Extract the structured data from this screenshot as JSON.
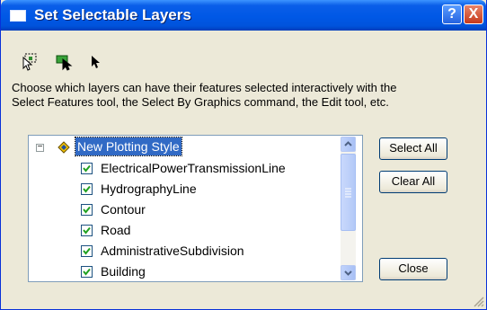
{
  "window": {
    "title": "Set Selectable Layers",
    "help_glyph": "?",
    "close_glyph": "X"
  },
  "toolbar": {
    "icons": [
      "select-features-icon",
      "select-by-graphics-icon",
      "edit-tool-icon"
    ]
  },
  "description": {
    "line1": "Choose which layers can have their features selected interactively with the",
    "line2": "Select Features tool, the Select By Graphics command, the Edit tool, etc."
  },
  "tree": {
    "expander": "−",
    "root_label": "New Plotting Style",
    "layers": [
      {
        "label": "ElectricalPowerTransmissionLine",
        "checked": true
      },
      {
        "label": "HydrographyLine",
        "checked": true
      },
      {
        "label": "Contour",
        "checked": true
      },
      {
        "label": "Road",
        "checked": true
      },
      {
        "label": "AdministrativeSubdivision",
        "checked": true
      },
      {
        "label": "Building",
        "checked": true
      }
    ]
  },
  "buttons": {
    "select_all": "Select All",
    "clear_all": "Clear All",
    "close": "Close"
  },
  "colors": {
    "titlebar": "#0054e3",
    "selection": "#316ac5",
    "dialog_face": "#ece9d8"
  }
}
